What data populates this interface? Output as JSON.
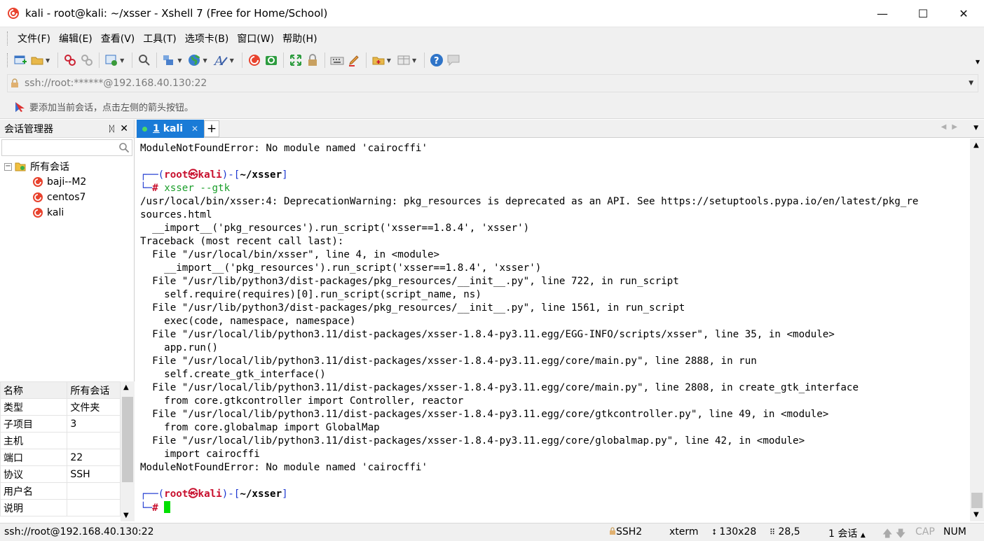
{
  "window": {
    "title": "kali - root@kali: ~/xsser - Xshell 7 (Free for Home/School)",
    "minimize": "—",
    "maximize": "☐",
    "close": "✕"
  },
  "menu": [
    "文件(F)",
    "编辑(E)",
    "查看(V)",
    "工具(T)",
    "选项卡(B)",
    "窗口(W)",
    "帮助(H)"
  ],
  "address": {
    "value": "ssh://root:******@192.168.40.130:22"
  },
  "hint": "要添加当前会话，点击左侧的箭头按钮。",
  "session_manager": {
    "title": "会话管理器",
    "pin": "ᛞ",
    "close": "✕",
    "root_label": "所有会话",
    "sessions": [
      "baji--M2",
      "centos7",
      "kali"
    ]
  },
  "properties": {
    "rows": [
      [
        "名称",
        "所有会话"
      ],
      [
        "类型",
        "文件夹"
      ],
      [
        "子项目",
        "3"
      ],
      [
        "主机",
        ""
      ],
      [
        "端口",
        "22"
      ],
      [
        "协议",
        "SSH"
      ],
      [
        "用户名",
        ""
      ],
      [
        "说明",
        ""
      ]
    ]
  },
  "tabs": {
    "active_number": "1",
    "active_name": "kali",
    "close": "✕",
    "add": "+"
  },
  "terminal": {
    "lines": [
      "ModuleNotFoundError: No module named 'cairocffi'",
      "",
      "__PROMPT1__",
      "__CMD__",
      "/usr/local/bin/xsser:4: DeprecationWarning: pkg_resources is deprecated as an API. See https://setuptools.pypa.io/en/latest/pkg_re",
      "sources.html",
      "  __import__('pkg_resources').run_script('xsser==1.8.4', 'xsser')",
      "Traceback (most recent call last):",
      "  File \"/usr/local/bin/xsser\", line 4, in <module>",
      "    __import__('pkg_resources').run_script('xsser==1.8.4', 'xsser')",
      "  File \"/usr/lib/python3/dist-packages/pkg_resources/__init__.py\", line 722, in run_script",
      "    self.require(requires)[0].run_script(script_name, ns)",
      "  File \"/usr/lib/python3/dist-packages/pkg_resources/__init__.py\", line 1561, in run_script",
      "    exec(code, namespace, namespace)",
      "  File \"/usr/local/lib/python3.11/dist-packages/xsser-1.8.4-py3.11.egg/EGG-INFO/scripts/xsser\", line 35, in <module>",
      "    app.run()",
      "  File \"/usr/local/lib/python3.11/dist-packages/xsser-1.8.4-py3.11.egg/core/main.py\", line 2888, in run",
      "    self.create_gtk_interface()",
      "  File \"/usr/local/lib/python3.11/dist-packages/xsser-1.8.4-py3.11.egg/core/main.py\", line 2808, in create_gtk_interface",
      "    from core.gtkcontroller import Controller, reactor",
      "  File \"/usr/local/lib/python3.11/dist-packages/xsser-1.8.4-py3.11.egg/core/gtkcontroller.py\", line 49, in <module>",
      "    from core.globalmap import GlobalMap",
      "  File \"/usr/local/lib/python3.11/dist-packages/xsser-1.8.4-py3.11.egg/core/globalmap.py\", line 42, in <module>",
      "    import cairocffi",
      "ModuleNotFoundError: No module named 'cairocffi'",
      "",
      "__PROMPT2__",
      "__PROMPT2B__"
    ],
    "prompt": {
      "corner_top": "┌──(",
      "user": "root",
      "at": "㉿",
      "host": "kali",
      "close": ")-[",
      "path": "~/xsser",
      "end": "]",
      "corner_bottom": "└─",
      "hash": "#"
    },
    "command": "xsser --gtk"
  },
  "status": {
    "connection": "ssh://root@192.168.40.130:22",
    "protocol": "SSH2",
    "term": "xterm",
    "size": "130x28",
    "cursor_pos": "28,5",
    "sessions": "1 会话",
    "cap": "CAP",
    "num": "NUM"
  }
}
